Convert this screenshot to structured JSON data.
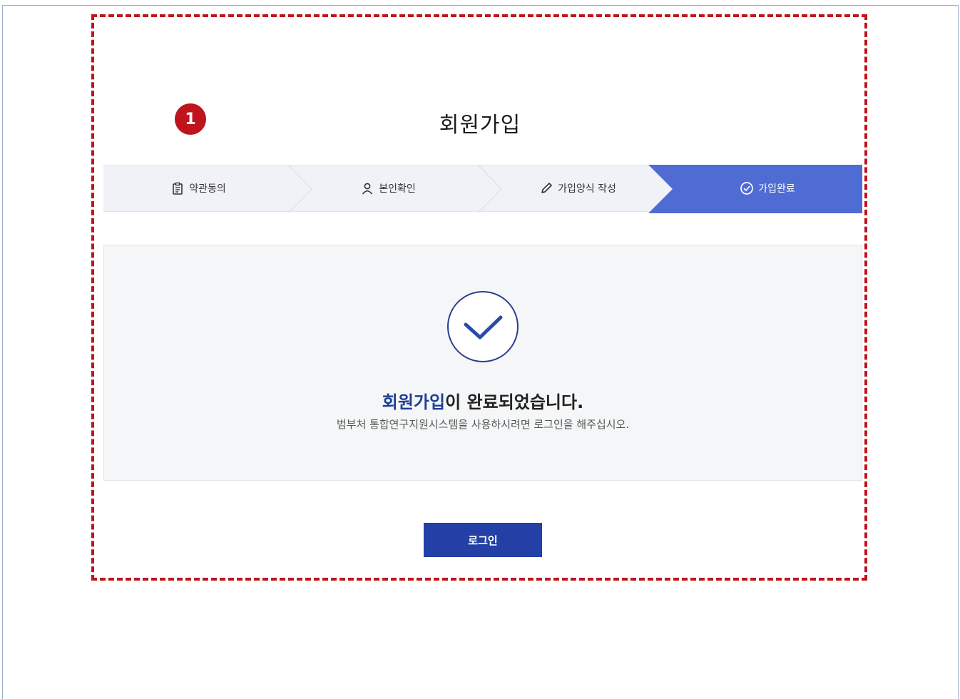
{
  "marker": {
    "number": "1"
  },
  "page": {
    "title": "회원가입"
  },
  "steps": [
    {
      "label": "약관동의",
      "icon": "clipboard-icon",
      "active": false
    },
    {
      "label": "본인확인",
      "icon": "person-icon",
      "active": false
    },
    {
      "label": "가입양식 작성",
      "icon": "pencil-icon",
      "active": false
    },
    {
      "label": "가입완료",
      "icon": "check-circle-icon",
      "active": true
    }
  ],
  "result": {
    "message_accent": "회원가입",
    "message_rest": "이 완료되었습니다.",
    "sub_message": "범부처 통합연구지원시스템을 사용하시려면 로그인을 해주십시오.",
    "icon": "check-circle-icon"
  },
  "actions": {
    "login_label": "로그인"
  },
  "colors": {
    "accent": "#1f3f93",
    "active_step": "#4f6bd4",
    "button": "#2340a6",
    "highlight": "#c0141c"
  }
}
